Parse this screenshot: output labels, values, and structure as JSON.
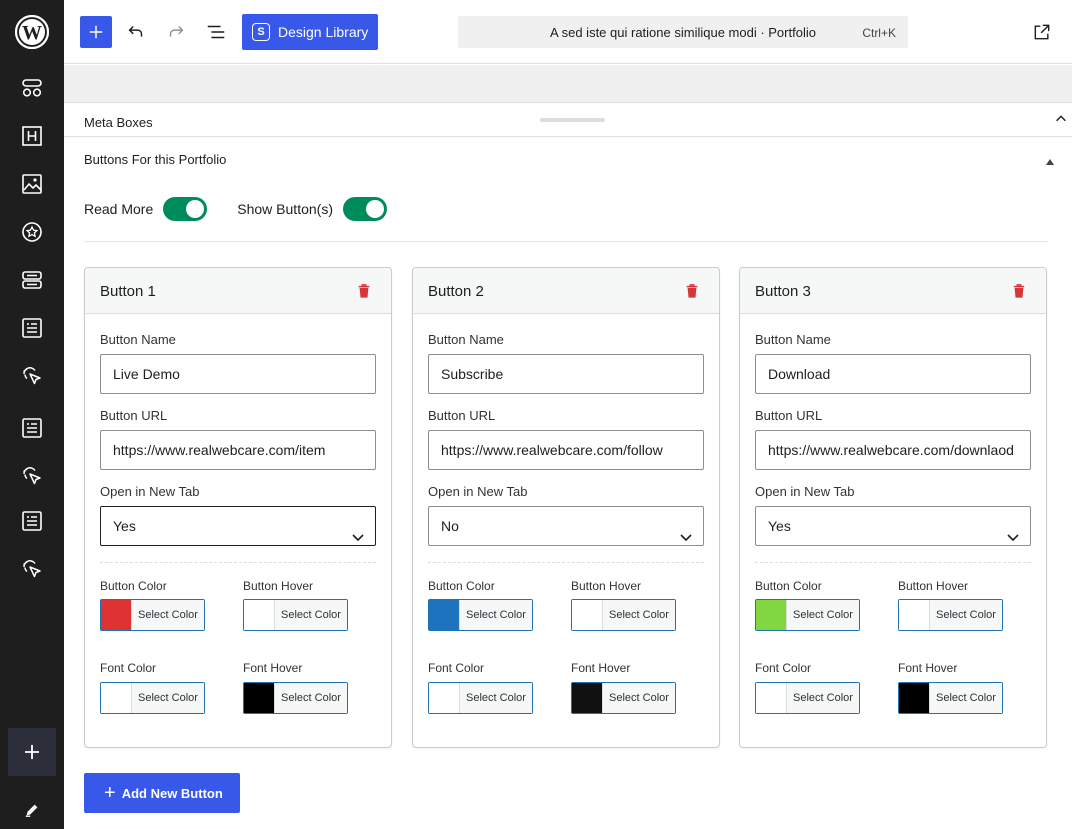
{
  "toolbar": {
    "design_library_label": "Design Library",
    "document_title": "A sed iste qui ratione similique modi · Portfolio",
    "shortcut": "Ctrl+K"
  },
  "meta_boxes": {
    "label": "Meta Boxes"
  },
  "panel": {
    "title": "Buttons For this Portfolio",
    "read_more_label": "Read More",
    "read_more_on": true,
    "show_buttons_label": "Show Button(s)",
    "show_buttons_on": true
  },
  "labels": {
    "button_name": "Button Name",
    "button_url": "Button URL",
    "open_new_tab": "Open in New Tab",
    "button_color": "Button Color",
    "button_hover": "Button Hover",
    "font_color": "Font Color",
    "font_hover": "Font Hover",
    "select_color": "Select Color"
  },
  "buttons": [
    {
      "title": "Button 1",
      "name": "Live Demo",
      "url": "https://www.realwebcare.com/item",
      "new_tab": "Yes",
      "button_color": "#dd3333",
      "button_hover": "#ffffff",
      "font_color": "#ffffff",
      "font_hover": "#000000"
    },
    {
      "title": "Button 2",
      "name": "Subscribe",
      "url": "https://www.realwebcare.com/follow",
      "new_tab": "No",
      "button_color": "#1e73be",
      "button_hover": "#ffffff",
      "font_color": "#ffffff",
      "font_hover": "#111111"
    },
    {
      "title": "Button 3",
      "name": "Download",
      "url": "https://www.realwebcare.com/downlaod",
      "new_tab": "Yes",
      "button_color": "#81d742",
      "button_hover": "#ffffff",
      "font_color": "#ffffff",
      "font_hover": "#000000"
    }
  ],
  "add_button_label": "Add New Button",
  "colors": {
    "accent": "#3858e9",
    "toggle_on": "#008c5a",
    "danger": "#d63638",
    "sidebar_bg": "#1e1e1e"
  },
  "icons": {
    "sidebar": [
      "wordpress-logo-icon",
      "patterns-icon",
      "heading-icon",
      "image-icon",
      "star-icon",
      "stack-icon",
      "post-list-icon",
      "cursor-click-icon",
      "post-list-icon",
      "cursor-click-icon",
      "post-list-icon",
      "cursor-click-icon",
      "plus-icon",
      "pencil-icon"
    ]
  }
}
